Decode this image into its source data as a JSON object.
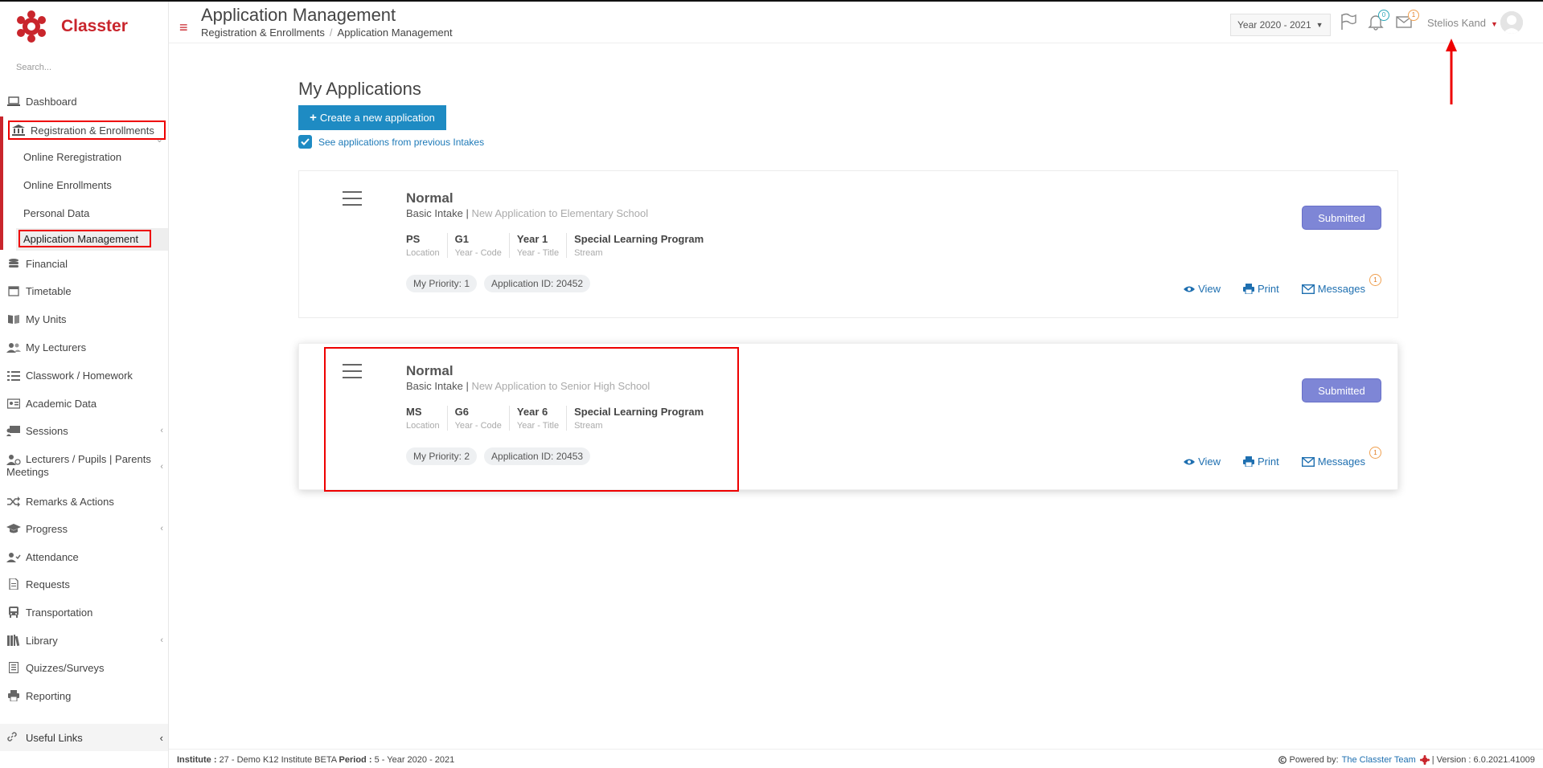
{
  "app": {
    "name": "Classter",
    "search_placeholder": "Search..."
  },
  "sidebar": {
    "items": [
      {
        "label": "Dashboard",
        "icon": "laptop-icon"
      },
      {
        "label": "Registration & Enrollments",
        "icon": "institution-icon"
      },
      {
        "label": "Financial",
        "icon": "coins-icon"
      },
      {
        "label": "Timetable",
        "icon": "calendar-icon"
      },
      {
        "label": "My Units",
        "icon": "book-icon"
      },
      {
        "label": "My Lecturers",
        "icon": "users-icon"
      },
      {
        "label": "Classwork / Homework",
        "icon": "list-icon"
      },
      {
        "label": "Academic Data",
        "icon": "id-card-icon"
      },
      {
        "label": "Sessions",
        "icon": "sessions-icon"
      },
      {
        "label": "Lecturers / Pupils | Parents",
        "label2": "Meetings",
        "icon": "meetings-icon"
      },
      {
        "label": "Remarks & Actions",
        "icon": "shuffle-icon"
      },
      {
        "label": "Progress",
        "icon": "graduation-cap-icon"
      },
      {
        "label": "Attendance",
        "icon": "user-check-icon"
      },
      {
        "label": "Requests",
        "icon": "document-icon"
      },
      {
        "label": "Transportation",
        "icon": "bus-icon"
      },
      {
        "label": "Library",
        "icon": "library-icon"
      },
      {
        "label": "Quizzes/Surveys",
        "icon": "checklist-icon"
      },
      {
        "label": "Reporting",
        "icon": "printer-icon"
      }
    ],
    "sub_items": [
      {
        "label": "Online Reregistration"
      },
      {
        "label": "Online Enrollments"
      },
      {
        "label": "Personal Data"
      },
      {
        "label": "Application Management"
      }
    ],
    "useful_links": "Useful Links"
  },
  "header": {
    "title": "Application Management",
    "breadcrumb": [
      "Registration & Enrollments",
      "Application Management"
    ],
    "year": "Year 2020 - 2021",
    "notifications_count": "0",
    "messages_count": "1",
    "user_name": "Stelios Kand"
  },
  "main": {
    "title": "My Applications",
    "create_button": "Create a new application",
    "previous_intakes_label": "See applications from previous Intakes",
    "view_label": "View",
    "print_label": "Print",
    "messages_label": "Messages",
    "applications": [
      {
        "title": "Normal",
        "intake": "Basic Intake",
        "description": "New Application to Elementary School",
        "fields": [
          {
            "value": "PS",
            "label": "Location"
          },
          {
            "value": "G1",
            "label": "Year - Code"
          },
          {
            "value": "Year 1",
            "label": "Year - Title"
          },
          {
            "value": "Special Learning Program",
            "label": "Stream"
          }
        ],
        "priority": "My Priority: 1",
        "application_id": "Application ID: 20452",
        "status": "Submitted",
        "messages_count": "1"
      },
      {
        "title": "Normal",
        "intake": "Basic Intake",
        "description": "New Application to Senior High School",
        "fields": [
          {
            "value": "MS",
            "label": "Location"
          },
          {
            "value": "G6",
            "label": "Year - Code"
          },
          {
            "value": "Year 6",
            "label": "Year - Title"
          },
          {
            "value": "Special Learning Program",
            "label": "Stream"
          }
        ],
        "priority": "My Priority: 2",
        "application_id": "Application ID: 20453",
        "status": "Submitted",
        "messages_count": "1"
      }
    ]
  },
  "footer": {
    "institute_label": "Institute :",
    "institute_value": "27 - Demo K12 Institute BETA",
    "period_label": "Period :",
    "period_value": "5 - Year 2020 - 2021",
    "powered_by": "Powered by:",
    "team": "The Classter Team",
    "version": "| Version : 6.0.2021.41009"
  },
  "colors": {
    "brand": "#c9252c",
    "primary": "#1e8bc3",
    "status_submitted": "#7e86d6",
    "highlight": "#ee0000"
  }
}
